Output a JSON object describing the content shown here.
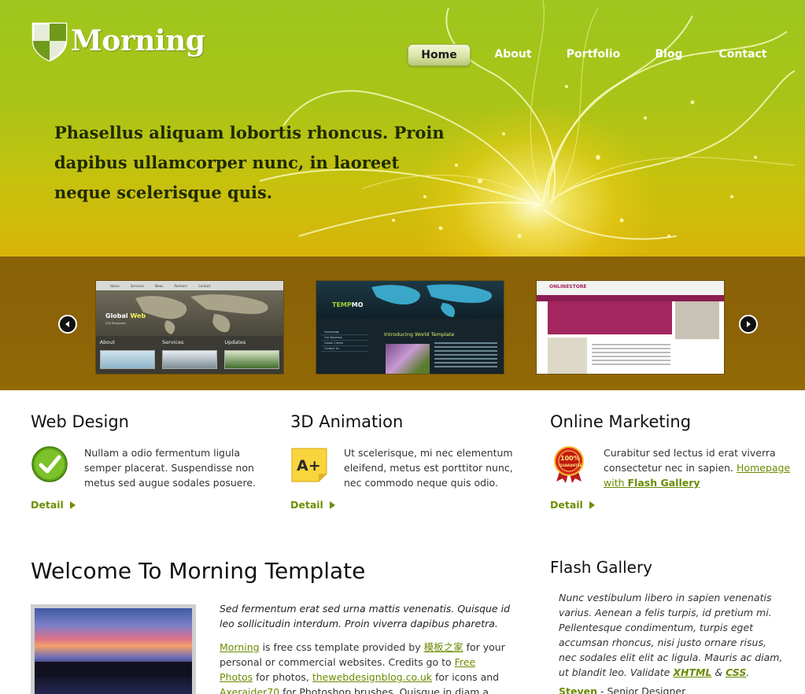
{
  "site": {
    "name": "Morning"
  },
  "nav": {
    "items": [
      {
        "label": "Home",
        "active": true
      },
      {
        "label": "About",
        "active": false
      },
      {
        "label": "Portfolio",
        "active": false
      },
      {
        "label": "Blog",
        "active": false
      },
      {
        "label": "Contact",
        "active": false
      }
    ]
  },
  "hero": {
    "headline": "Phasellus aliquam lobortis rhoncus. Proin dapibus ullamcorper nunc, in laoreet neque scelerisque quis."
  },
  "slider": {
    "thumbs": [
      {
        "menu": [
          "Home",
          "Services",
          "News",
          "Partners",
          "Contact"
        ],
        "title_a": "Global",
        "title_b": "Web",
        "subtitle": "CSS Templates",
        "cols": [
          "About",
          "Services",
          "Updates"
        ]
      },
      {
        "title_a": "TEMP",
        "title_b": "MO",
        "intro": "Introducing World Template",
        "menu": [
          "Homepage",
          "Our Business",
          "Global Clients",
          "Contact Us"
        ]
      },
      {
        "title": "ONLINESTORE"
      }
    ]
  },
  "services": [
    {
      "title": "Web Design",
      "text": "Nullam a odio fermentum ligula semper placerat. Suspendisse non metus sed augue sodales posuere.",
      "detail": "Detail",
      "icon": "check-icon"
    },
    {
      "title": "3D Animation",
      "text": "Ut scelerisque, mi nec elementum eleifend, metus est porttitor nunc, nec commodo neque quis odio.",
      "detail": "Detail",
      "icon": "grade-a-plus-icon"
    },
    {
      "title": "Online Marketing",
      "text_before": "Curabitur sed lectus id erat viverra consectetur nec in sapien.",
      "link_1": "Homepage",
      "link_mid": "with",
      "link_2": "Flash Gallery",
      "detail": "Detail",
      "icon": "guarantee-badge-icon"
    }
  ],
  "welcome": {
    "title": "Welcome To Morning Template",
    "intro": "Sed fermentum erat sed urna mattis venenatis. Quisque id leo sollicitudin interdum. Proin viverra dapibus pharetra.",
    "body": {
      "link_morning": "Morning",
      "t1": " is free css template provided by ",
      "link_cn": "模板之家",
      "t2": " for your personal or commercial websites. Credits go to ",
      "link_photos": "Free Photos",
      "t3": " for photos, ",
      "link_twd": "thewebdesignblog.co.uk",
      "t4": " for icons and ",
      "link_axe": "Axeraider70",
      "t5": " for Photoshop brushes. Quisque in diam a justo condimentum"
    }
  },
  "flash_gallery": {
    "title": "Flash Gallery",
    "text": "Nunc vestibulum libero in sapien venenatis varius. Aenean a felis turpis, id pretium mi. Pellentesque condimentum, turpis eget accumsan rhoncus, nisi justo ornare risus, nec sodales elit elit ac ligula. Mauris ac diam, ut blandit leo. Validate ",
    "link_xhtml": "XHTML",
    "amp": " & ",
    "link_css": "CSS",
    "end": ".",
    "author_name": "Steven",
    "author_role": " - Senior Designer"
  },
  "colors": {
    "accent_green": "#6a8b00",
    "hero_green": "#9ec61e",
    "band_brown": "#8a6208"
  }
}
